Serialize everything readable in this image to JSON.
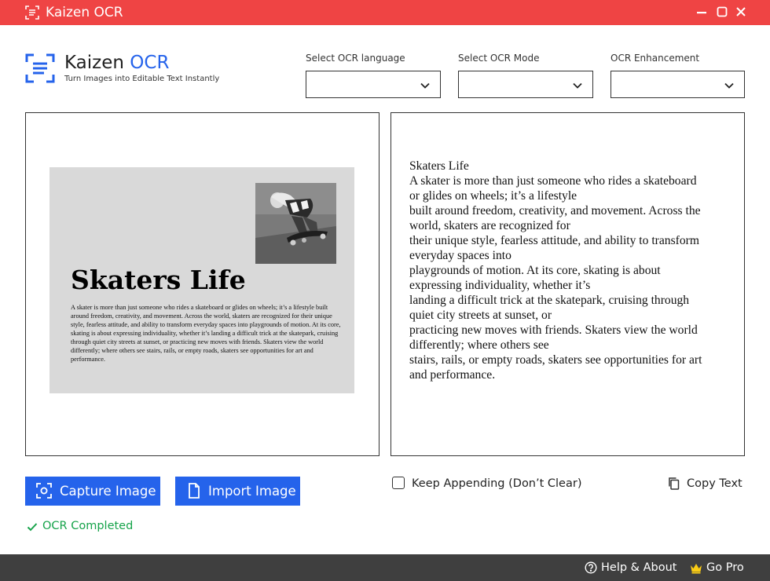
{
  "window": {
    "title": "Kaizen OCR",
    "controls": [
      "minimize-icon",
      "maximize-icon",
      "close-icon"
    ]
  },
  "brand": {
    "name_part1": "Kaizen",
    "name_part2": "OCR",
    "tagline": "Turn Images into Editable Text Instantly",
    "accent_color": "#2563eb"
  },
  "selects": {
    "language": {
      "label": "Select OCR language",
      "value": ""
    },
    "mode": {
      "label": "Select OCR Mode",
      "value": ""
    },
    "enhancement": {
      "label": "OCR Enhancement",
      "value": ""
    }
  },
  "preview": {
    "doc_title": "Skaters Life",
    "doc_body": "A skater is more than just someone who rides a skateboard or glides on wheels; it’s a lifestyle built around freedom, creativity, and movement. Across the world, skaters are recognized for their unique style, fearless attitude, and ability to transform everyday spaces into playgrounds of motion. At its core, skating is about expressing individuality, whether it’s landing a difficult trick at the skatepark, cruising through quiet city streets at sunset, or practicing new moves with friends. Skaters view the world differently; where others see stairs, rails, or empty roads, skaters see opportunities for art and performance."
  },
  "output": {
    "lines": [
      "Skaters Life",
      "A skater is more than just someone who rides a skateboard",
      "or glides on wheels; it’s a lifestyle",
      "built around freedom, creativity, and movement. Across the",
      "world, skaters are recognized for",
      "their unique style, fearless attitude, and ability to transform",
      "everyday spaces into",
      "playgrounds of motion. At its core, skating is about",
      "expressing individuality, whether it’s",
      "landing a difficult trick at the skatepark, cruising through",
      "quiet city streets at sunset, or",
      "practicing new moves with friends. Skaters view the world",
      "differently; where others see",
      "stairs, rails, or empty roads, skaters see opportunities for art",
      "and performance."
    ]
  },
  "actions": {
    "capture_label": "Capture Image",
    "import_label": "Import Image",
    "append_label": "Keep Appending (Don’t Clear)",
    "append_checked": false,
    "copy_label": "Copy Text"
  },
  "status": {
    "text": "OCR Completed",
    "color": "#16a34a"
  },
  "footer": {
    "help_label": "Help & About",
    "gopro_label": "Go Pro"
  },
  "colors": {
    "titlebar": "#ef4444",
    "button": "#2563eb",
    "footer": "#3f3f3f",
    "crown": "#facc15"
  }
}
